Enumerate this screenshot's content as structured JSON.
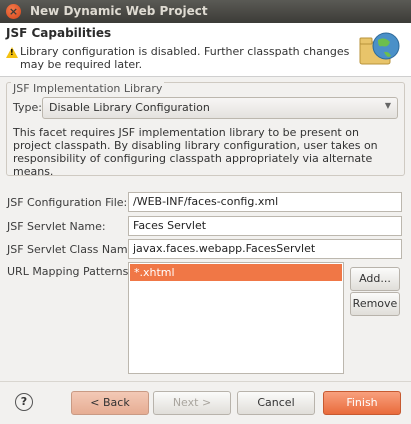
{
  "window": {
    "title": "New Dynamic Web Project"
  },
  "banner": {
    "heading": "JSF Capabilities",
    "message": "Library configuration is disabled. Further classpath changes may be required later."
  },
  "implementation": {
    "group_label": "JSF Implementation Library",
    "type_label": "Type:",
    "type_value": "Disable Library Configuration",
    "description": "This facet requires JSF implementation library to be present on project classpath. By disabling library configuration, user takes on responsibility of configuring classpath appropriately via alternate means."
  },
  "config": {
    "config_file_label": "JSF Configuration File:",
    "config_file_value": "/WEB-INF/faces-config.xml",
    "servlet_name_label": "JSF Servlet Name:",
    "servlet_name_value": "Faces Servlet",
    "servlet_class_label": "JSF Servlet Class Name:",
    "servlet_class_value": "javax.faces.webapp.FacesServlet",
    "url_patterns_label": "URL Mapping Patterns:",
    "url_patterns": [
      "*.xhtml"
    ],
    "add_label": "Add...",
    "remove_label": "Remove"
  },
  "footer": {
    "help": "?",
    "back_label": "< Back",
    "next_label": "Next >",
    "cancel_label": "Cancel",
    "finish_label": "Finish"
  }
}
